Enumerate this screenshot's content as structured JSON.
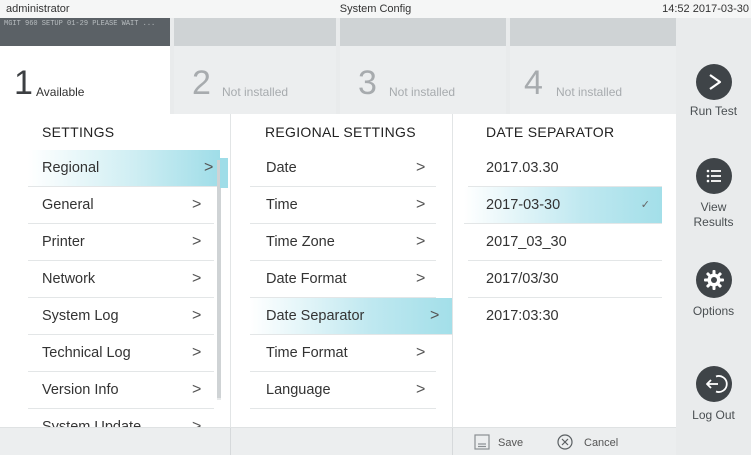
{
  "topbar": {
    "user": "administrator",
    "title": "System Config",
    "clock": "14:52 2017-03-30"
  },
  "modules": [
    {
      "num": "1",
      "label": "Available",
      "bar_text": "MGIT 960 SETUP 01-29 PLEASE WAIT ...",
      "active": true
    },
    {
      "num": "2",
      "label": "Not installed",
      "active": false
    },
    {
      "num": "3",
      "label": "Not installed",
      "active": false
    },
    {
      "num": "4",
      "label": "Not installed",
      "active": false
    }
  ],
  "sidebar": {
    "run_test": "Run Test",
    "view_results_1": "View",
    "view_results_2": "Results",
    "options": "Options",
    "log_out": "Log Out"
  },
  "settings": {
    "heading": "SETTINGS",
    "items": [
      "Regional",
      "General",
      "Printer",
      "Network",
      "System Log",
      "Technical Log",
      "Version Info",
      "System Update"
    ],
    "selected": "Regional"
  },
  "regional": {
    "heading": "REGIONAL SETTINGS",
    "items": [
      "Date",
      "Time",
      "Time Zone",
      "Date Format",
      "Date Separator",
      "Time Format",
      "Language"
    ],
    "selected": "Date Separator"
  },
  "separator": {
    "heading": "DATE SEPARATOR",
    "items": [
      "2017.03.30",
      "2017-03-30",
      "2017_03_30",
      "2017/03/30",
      "2017:03:30"
    ],
    "selected": "2017-03-30"
  },
  "chevron": ">",
  "check": "✓",
  "bottom": {
    "save": "Save",
    "cancel": "Cancel"
  }
}
